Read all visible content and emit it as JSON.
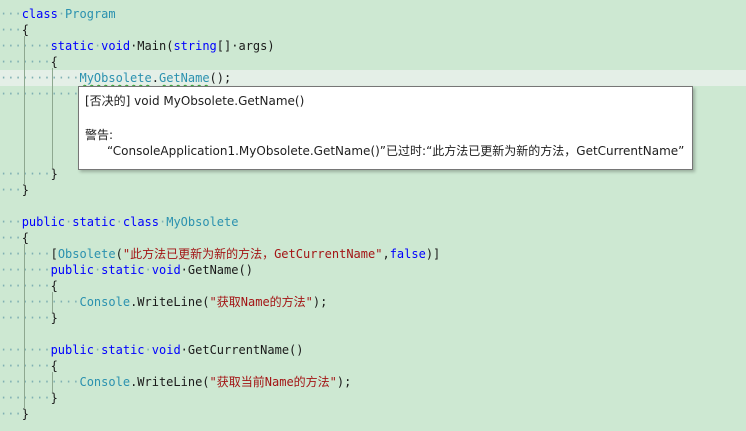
{
  "code": {
    "lines": [
      {
        "indent": "···",
        "tokens": [
          {
            "t": "class",
            "c": "kw"
          },
          {
            "t": "·",
            "c": "indent"
          },
          {
            "t": "Program",
            "c": "type"
          }
        ]
      },
      {
        "indent": "···",
        "tokens": [
          {
            "t": "{",
            "c": "plain"
          }
        ]
      },
      {
        "indent": "·······",
        "tokens": [
          {
            "t": "static",
            "c": "kw"
          },
          {
            "t": "·",
            "c": "indent"
          },
          {
            "t": "void",
            "c": "kw"
          },
          {
            "t": "·Main(",
            "c": "plain"
          },
          {
            "t": "string",
            "c": "kw"
          },
          {
            "t": "[]·args)",
            "c": "plain"
          }
        ]
      },
      {
        "indent": "·······",
        "tokens": [
          {
            "t": "{",
            "c": "plain"
          }
        ]
      },
      {
        "indent": "···········",
        "tokens": [
          {
            "t": "MyObsolete",
            "c": "type squiggle"
          },
          {
            "t": ".",
            "c": "plain"
          },
          {
            "t": "GetName",
            "c": "type squiggle"
          },
          {
            "t": "();",
            "c": "plain"
          }
        ]
      },
      {
        "indent": "···········",
        "tokens": []
      },
      {
        "indent": "",
        "tokens": []
      },
      {
        "indent": "",
        "tokens": []
      },
      {
        "indent": "",
        "tokens": []
      },
      {
        "indent": "",
        "tokens": []
      },
      {
        "indent": "·······",
        "tokens": [
          {
            "t": "}",
            "c": "plain"
          }
        ]
      },
      {
        "indent": "···",
        "tokens": [
          {
            "t": "}",
            "c": "plain"
          }
        ]
      },
      {
        "indent": "",
        "tokens": []
      },
      {
        "indent": "···",
        "tokens": [
          {
            "t": "public",
            "c": "kw"
          },
          {
            "t": "·",
            "c": "indent"
          },
          {
            "t": "static",
            "c": "kw"
          },
          {
            "t": "·",
            "c": "indent"
          },
          {
            "t": "class",
            "c": "kw"
          },
          {
            "t": "·",
            "c": "indent"
          },
          {
            "t": "MyObsolete",
            "c": "type"
          }
        ]
      },
      {
        "indent": "···",
        "tokens": [
          {
            "t": "{",
            "c": "plain"
          }
        ]
      },
      {
        "indent": "·······",
        "tokens": [
          {
            "t": "[",
            "c": "plain"
          },
          {
            "t": "Obsolete",
            "c": "type"
          },
          {
            "t": "(",
            "c": "plain"
          },
          {
            "t": "\"此方法已更新为新的方法，GetCurrentName\"",
            "c": "str"
          },
          {
            "t": ",",
            "c": "plain"
          },
          {
            "t": "false",
            "c": "kw"
          },
          {
            "t": ")]",
            "c": "plain"
          }
        ]
      },
      {
        "indent": "·······",
        "tokens": [
          {
            "t": "public",
            "c": "kw"
          },
          {
            "t": "·",
            "c": "indent"
          },
          {
            "t": "static",
            "c": "kw"
          },
          {
            "t": "·",
            "c": "indent"
          },
          {
            "t": "void",
            "c": "kw"
          },
          {
            "t": "·GetName()",
            "c": "plain"
          }
        ]
      },
      {
        "indent": "·······",
        "tokens": [
          {
            "t": "{",
            "c": "plain"
          }
        ]
      },
      {
        "indent": "···········",
        "tokens": [
          {
            "t": "Console",
            "c": "type"
          },
          {
            "t": ".WriteLine(",
            "c": "plain"
          },
          {
            "t": "\"获取Name的方法\"",
            "c": "str"
          },
          {
            "t": ");",
            "c": "plain"
          }
        ]
      },
      {
        "indent": "·······",
        "tokens": [
          {
            "t": "}",
            "c": "plain"
          }
        ]
      },
      {
        "indent": "",
        "tokens": []
      },
      {
        "indent": "·······",
        "tokens": [
          {
            "t": "public",
            "c": "kw"
          },
          {
            "t": "·",
            "c": "indent"
          },
          {
            "t": "static",
            "c": "kw"
          },
          {
            "t": "·",
            "c": "indent"
          },
          {
            "t": "void",
            "c": "kw"
          },
          {
            "t": "·GetCurrentName()",
            "c": "plain"
          }
        ]
      },
      {
        "indent": "·······",
        "tokens": [
          {
            "t": "{",
            "c": "plain"
          }
        ]
      },
      {
        "indent": "···········",
        "tokens": [
          {
            "t": "Console",
            "c": "type"
          },
          {
            "t": ".WriteLine(",
            "c": "plain"
          },
          {
            "t": "\"获取当前Name的方法\"",
            "c": "str"
          },
          {
            "t": ");",
            "c": "plain"
          }
        ]
      },
      {
        "indent": "·······",
        "tokens": [
          {
            "t": "}",
            "c": "plain"
          }
        ]
      },
      {
        "indent": "···",
        "tokens": [
          {
            "t": "}",
            "c": "plain"
          }
        ]
      }
    ]
  },
  "tooltip": {
    "signature": "[否决的] void MyObsolete.GetName()",
    "warning_label": "警告:",
    "warning_text": "“ConsoleApplication1.MyObsolete.GetName()”已过时:“此方法已更新为新的方法，GetCurrentName”"
  },
  "colors": {
    "background": "#cde8d2",
    "keyword": "#0000ff",
    "type": "#2b91af",
    "string": "#a31515",
    "squiggle": "#2e9e2e"
  }
}
